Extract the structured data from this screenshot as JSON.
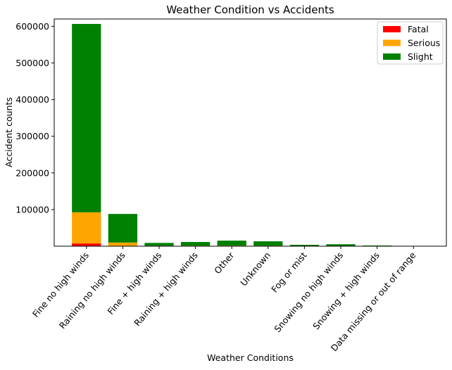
{
  "chart_data": {
    "type": "bar",
    "stacked": true,
    "title": "Weather Condition vs Accidents",
    "xlabel": "Weather Conditions",
    "ylabel": "Accident counts",
    "ylim": [
      0,
      620000
    ],
    "yticks": [
      100000,
      200000,
      300000,
      400000,
      500000,
      600000
    ],
    "legend_position": "top-right",
    "categories": [
      "Fine no high winds",
      "Raining no high winds",
      "Fine + high winds",
      "Raining + high winds",
      "Other",
      "Unknown",
      "Fog or mist",
      "Snowing no high winds",
      "Snowing + high winds",
      "Data missing or out of range"
    ],
    "series": [
      {
        "name": "Fatal",
        "color": "#ff0000",
        "values": [
          7500,
          1000,
          200,
          150,
          150,
          100,
          80,
          50,
          20,
          0
        ]
      },
      {
        "name": "Serious",
        "color": "#ffa500",
        "values": [
          85000,
          9000,
          1000,
          1300,
          1500,
          1200,
          400,
          600,
          200,
          0
        ]
      },
      {
        "name": "Slight",
        "color": "#008000",
        "values": [
          514000,
          78000,
          7800,
          10000,
          13500,
          12000,
          3300,
          4700,
          1600,
          100
        ]
      }
    ]
  }
}
